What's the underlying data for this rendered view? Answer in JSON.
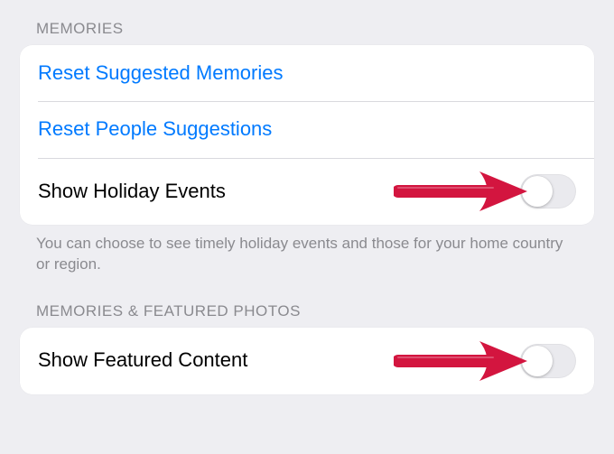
{
  "section1": {
    "header": "Memories",
    "rows": {
      "reset_memories": "Reset Suggested Memories",
      "reset_people": "Reset People Suggestions",
      "holiday_label": "Show Holiday Events",
      "holiday_on": false
    },
    "footer": "You can choose to see timely holiday events and those for your home country or region."
  },
  "section2": {
    "header": "Memories & Featured Photos",
    "rows": {
      "featured_label": "Show Featured Content",
      "featured_on": false
    }
  },
  "annotation": {
    "arrow_color": "#d3153f"
  }
}
